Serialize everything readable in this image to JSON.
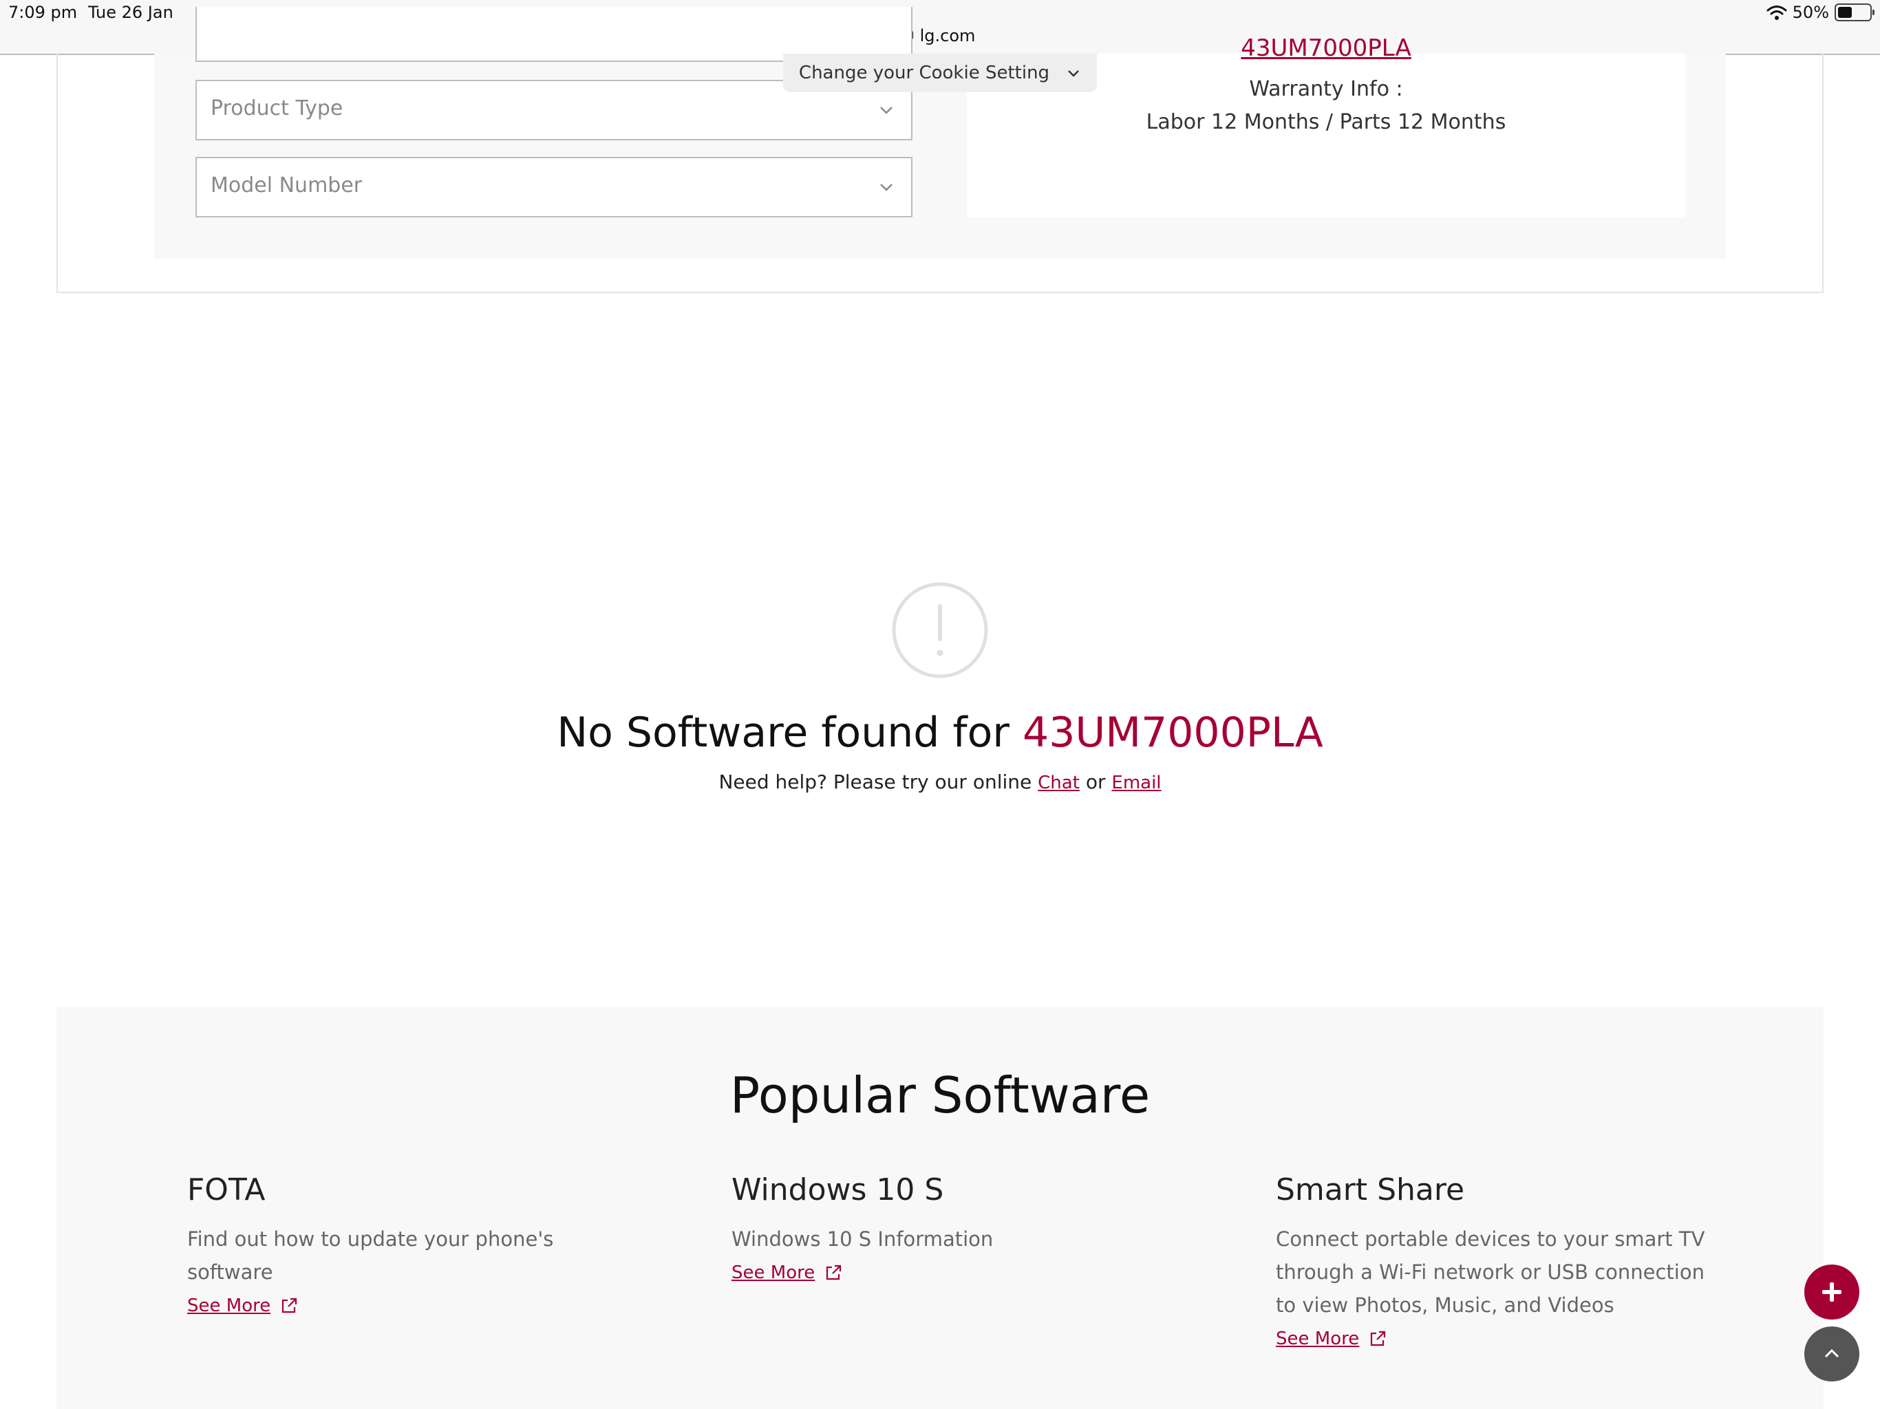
{
  "status_bar": {
    "time": "7:09 pm",
    "date": "Tue 26 Jan",
    "url": "lg.com",
    "battery": "50%"
  },
  "selector": {
    "product_type_placeholder": "Product Type",
    "model_number_placeholder": "Model Number"
  },
  "warranty": {
    "model": "43UM7000PLA",
    "title": "Warranty Info :",
    "detail": "Labor 12 Months / Parts 12 Months"
  },
  "cookie": {
    "label": "Change your Cookie Setting"
  },
  "no_software": {
    "title_prefix": "No Software found for",
    "model": "43UM7000PLA",
    "help_prefix": "Need help? Please try our online",
    "chat_label": "Chat",
    "or_label": "or",
    "email_label": "Email"
  },
  "popular": {
    "title": "Popular Software",
    "items": [
      {
        "name": "FOTA",
        "description": "Find out how to update your phone's software",
        "link": "See More"
      },
      {
        "name": "Windows 10 S",
        "description": "Windows 10 S Information",
        "link": "See More"
      },
      {
        "name": "Smart Share",
        "description": "Connect portable devices to your smart TV through a Wi-Fi network or USB connection to view Photos, Music, and Videos",
        "link": "See More"
      }
    ]
  },
  "colors": {
    "accent": "#a50034",
    "panel_bg": "#f8f8f8"
  },
  "icons": {
    "alert": "exclamation-circle-icon",
    "external": "external-link-icon",
    "plus": "plus-icon",
    "scroll_top": "chevron-up-icon"
  }
}
